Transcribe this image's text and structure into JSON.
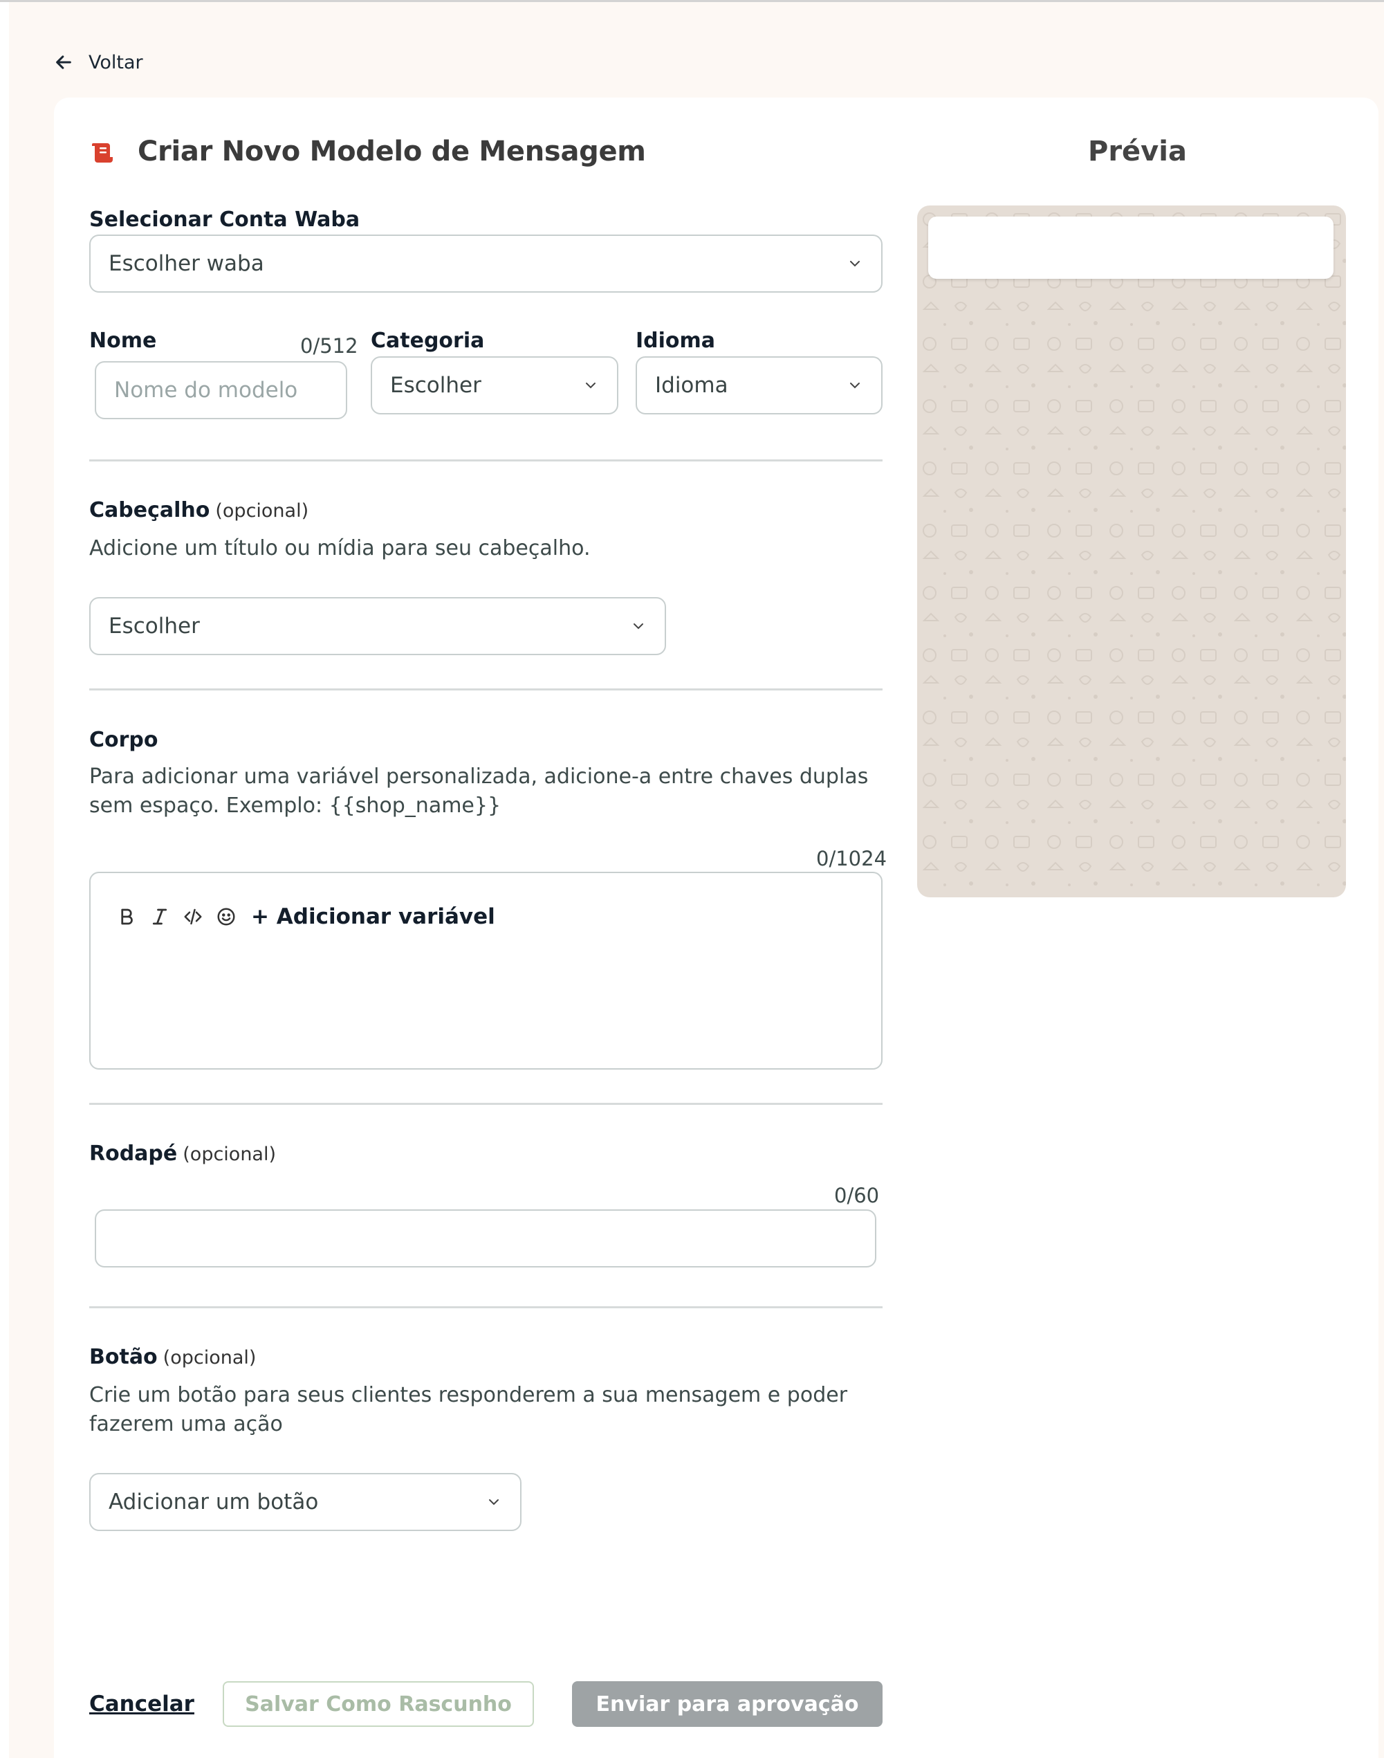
{
  "back": {
    "label": "Voltar"
  },
  "header": {
    "title": "Criar Novo Modelo de Mensagem",
    "preview_title": "Prévia"
  },
  "waba": {
    "label": "Selecionar Conta Waba",
    "value": "Escolher waba"
  },
  "name": {
    "label": "Nome",
    "counter": "0/512",
    "placeholder": "Nome do modelo",
    "value": ""
  },
  "category": {
    "label": "Categoria",
    "value": "Escolher"
  },
  "language": {
    "label": "Idioma",
    "value": "Idioma"
  },
  "header_section": {
    "label": "Cabeçalho",
    "optional": "(opcional)",
    "help": "Adicione um título ou mídia para seu cabeçalho.",
    "value": "Escolher"
  },
  "body_section": {
    "label": "Corpo",
    "help_line1": "Para adicionar uma variável personalizada, adicione-a entre chaves duplas",
    "help_line2": "sem espaço. Exemplo: {{shop_name}}",
    "counter": "0/1024",
    "add_variable": "+ Adicionar variável",
    "toolbar_icons": [
      "bold-icon",
      "italic-icon",
      "code-icon",
      "emoji-icon"
    ]
  },
  "footer_section": {
    "label": "Rodapé",
    "optional": "(opcional)",
    "counter": "0/60",
    "value": ""
  },
  "button_section": {
    "label": "Botão",
    "optional": "(opcional)",
    "help_line1": "Crie um botão para seus clientes responderem a sua mensagem e poder",
    "help_line2": "fazerem uma ação",
    "value": "Adicionar um botão"
  },
  "actions": {
    "cancel": "Cancelar",
    "save_draft": "Salvar Como Rascunho",
    "submit": "Enviar para aprovação"
  },
  "colors": {
    "accent": "#d9412e",
    "page_background": "#fdf8f4",
    "preview_background": "#e5ddd5",
    "submit_disabled": "#9ea3a5",
    "draft_border": "#c8d9c3"
  }
}
